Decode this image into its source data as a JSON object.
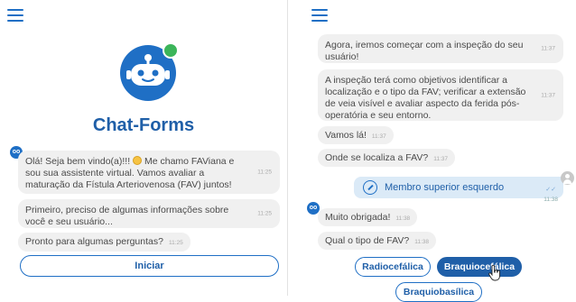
{
  "left": {
    "brand": {
      "title": "Chat-Forms"
    },
    "messages": [
      {
        "text_before": "Olá! Seja bem vindo(a)!!! ",
        "text_after": " Me chamo FAViana e sou sua assistente virtual. Vamos avaliar a maturação da Fístula Arteriovenosa (FAV) juntos!",
        "time": "11:25"
      },
      {
        "text": "Primeiro, preciso de algumas informações sobre você e seu usuário...",
        "time": "11:25"
      },
      {
        "text": "Pronto para algumas perguntas?",
        "time": "11:25"
      }
    ],
    "start_button": "Iniciar"
  },
  "right": {
    "messages": [
      {
        "text": "Agora, iremos começar com a inspeção do seu usuário!",
        "time": "11:37"
      },
      {
        "text": "A inspeção terá como objetivos identificar a localização e o tipo da FAV; verificar a extensão de veia visível e avaliar aspecto da ferida pós-operatória e seu entorno.",
        "time": "11:37"
      },
      {
        "text": "Vamos lá!",
        "time": "11:37"
      },
      {
        "text": "Onde se localiza a FAV?",
        "time": "11:37"
      }
    ],
    "user_reply": {
      "text": "Membro superior esquerdo",
      "time": "11:38"
    },
    "bot_messages": [
      {
        "text": "Muito obrigada!",
        "time": "11:38"
      },
      {
        "text": "Qual o tipo de FAV?",
        "time": "11:38"
      }
    ],
    "options": [
      "Radiocefálica",
      "Braquiocefálica",
      "Braquiobasílica"
    ]
  },
  "colors": {
    "primary": "#1f5fa8",
    "online_dot": "#3cb55a",
    "bubble": "#f0f0f0",
    "user_bubble": "#dbeaf7"
  },
  "icons": [
    "menu-icon",
    "robot-logo-icon",
    "bot-avatar-icon",
    "user-avatar-icon",
    "pen-icon",
    "hand-cursor-icon",
    "emoji-icon"
  ]
}
